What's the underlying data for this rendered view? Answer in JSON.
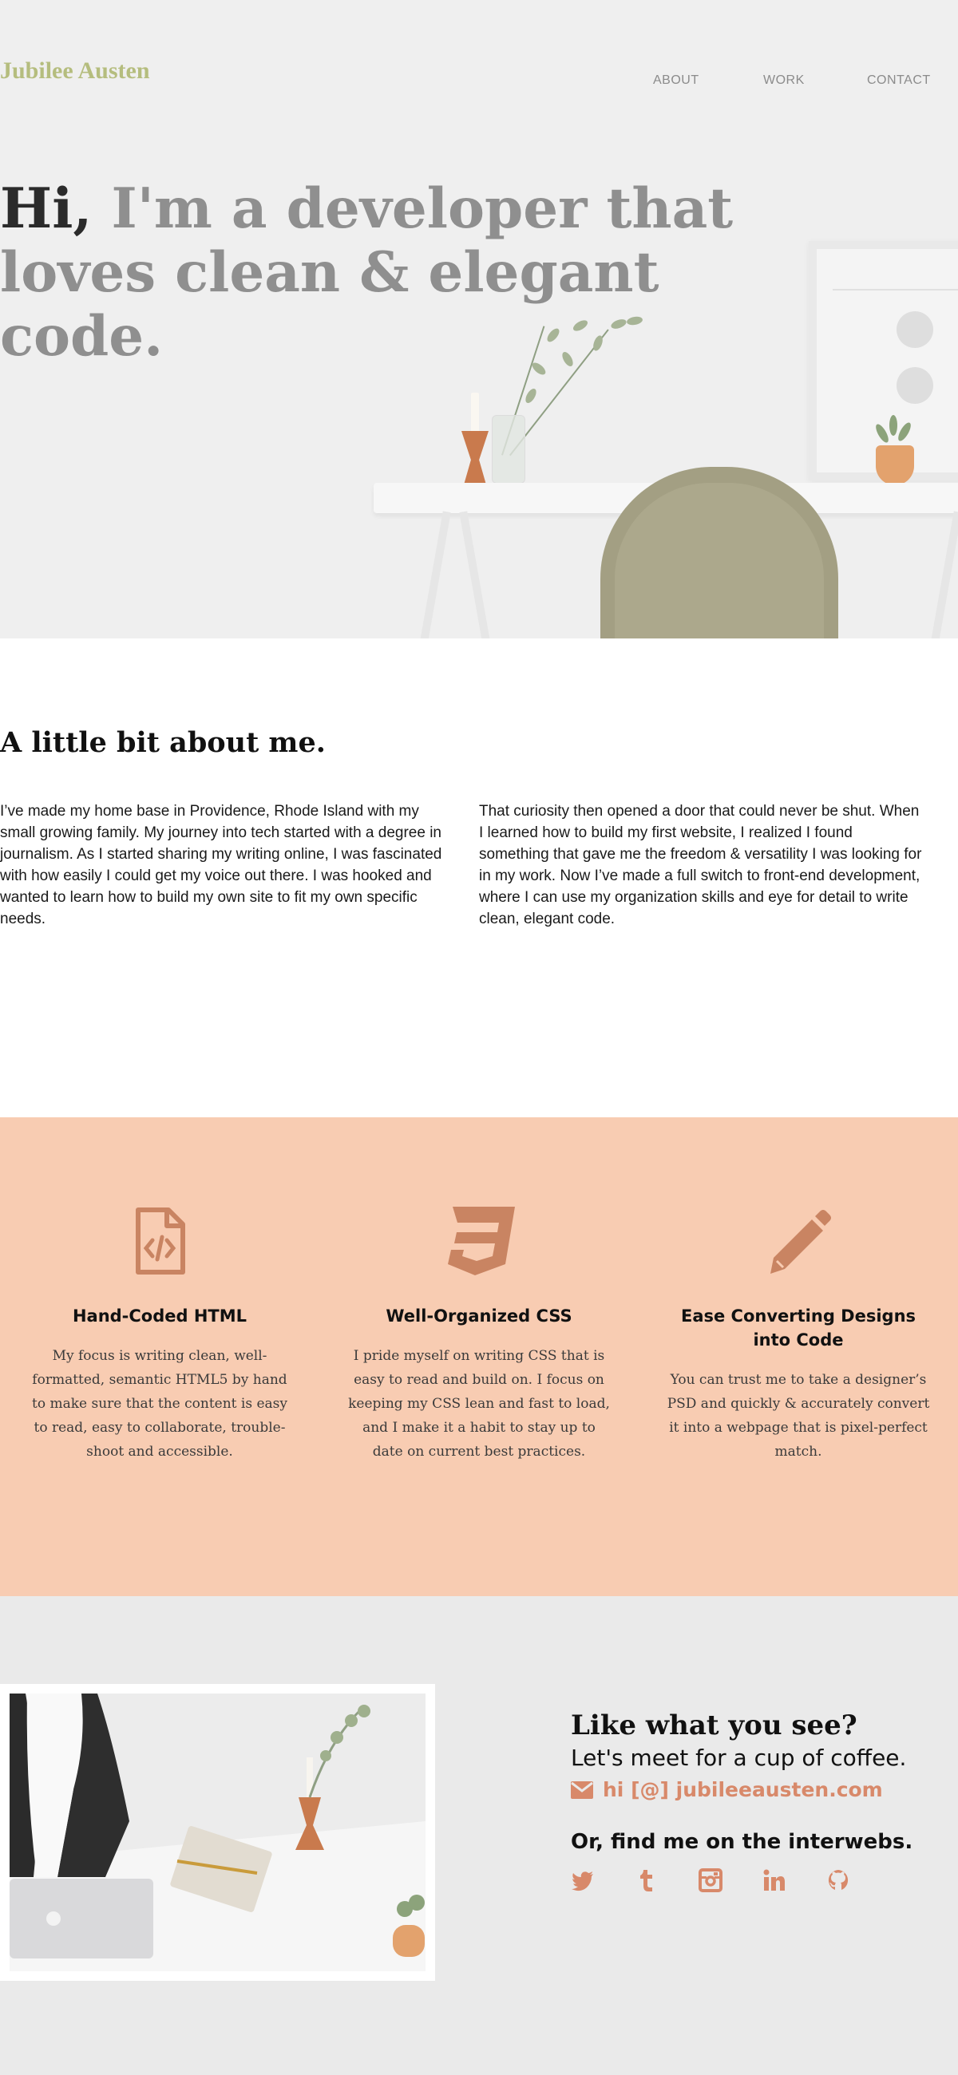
{
  "header": {
    "logo": "Jubilee Austen",
    "nav": [
      "ABOUT",
      "WORK",
      "CONTACT"
    ]
  },
  "hero": {
    "greeting": "Hi,",
    "line": "I'm a developer that loves clean & elegant code."
  },
  "about": {
    "title": "A little bit about me.",
    "paragraphs": [
      "I’ve made my home base in Providence, Rhode Island with my small growing family. My journey into tech started with a degree in journalism. As I started sharing my writing online, I was fascinated with how easily I could get my voice out there. I was hooked and wanted to learn how to build my own site to fit my own specific needs.",
      "That curiosity then opened a door that could never be shut. When I learned how to build my first website, I realized I found something that gave me the freedom & versatility I was looking for in my work. Now I’ve made a full switch to front-end development, where I can use my organization skills and eye for detail to write clean, elegant code."
    ]
  },
  "skills": [
    {
      "icon": "html-file-icon",
      "title": "Hand-Coded HTML",
      "text": "My focus is writing clean, well-formatted, semantic HTML5 by hand to make sure that the content is easy to read, easy to collaborate, trouble-shoot and accessible."
    },
    {
      "icon": "css3-icon",
      "title": "Well-Organized CSS",
      "text": "I pride myself on writing CSS that is easy to read and build on. I focus on keeping my CSS lean and fast to load, and I make it a habit to stay up to date on current best practices."
    },
    {
      "icon": "pencil-icon",
      "title": "Ease Converting Designs into Code",
      "text": "You can trust me to take a designer’s PSD and quickly & accurately convert it into a webpage that is pixel-perfect match."
    }
  ],
  "contact": {
    "title": "Like what you see?",
    "subtitle": "Let's meet for a cup of coffee.",
    "email": "hi [@] jubileeausten.com",
    "find": "Or, find me on the interwebs.",
    "socials": [
      "twitter-icon",
      "tumblr-icon",
      "instagram-icon",
      "linkedin-icon",
      "github-icon"
    ]
  },
  "colors": {
    "logo": "#b5bd7e",
    "accent": "#d8896a",
    "skills_bg": "#f8ccb2",
    "contact_bg": "#eaeaea"
  }
}
